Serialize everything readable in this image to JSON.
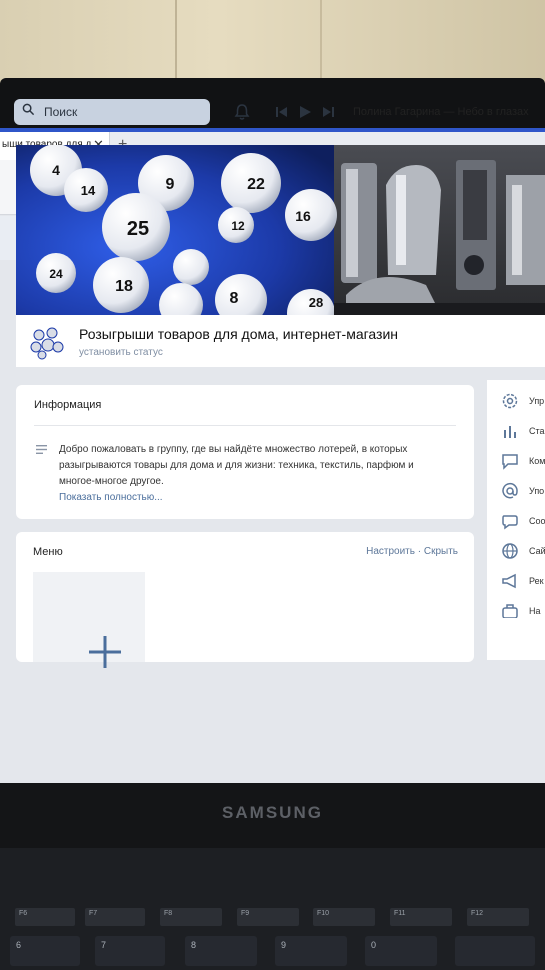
{
  "browser": {
    "tab_title": "ыши товаров для д",
    "tab_close": "✕",
    "new_tab": "+"
  },
  "header": {
    "search_placeholder": "Поиск",
    "now_playing": "Полина Гагарина — Небо в глазах"
  },
  "cover": {
    "ball_numbers": [
      "4",
      "14",
      "9",
      "22",
      "25",
      "12",
      "16",
      "24",
      "18",
      "8",
      "28"
    ]
  },
  "group": {
    "name": "Розыгрыши товаров для дома, интернет-магазин",
    "status_link": "установить статус"
  },
  "info": {
    "title": "Информация",
    "description": "Добро пожаловать в группу, где вы найдёте множество лотерей, в которых разыгрываются товары для дома и для жизни: техника, текстиль, парфюм и многое-многое другое.",
    "show_more": "Показать полностью..."
  },
  "menu": {
    "title": "Меню",
    "actions": "Настроить · Скрыть"
  },
  "sidebar": {
    "items": [
      {
        "label": "Упр",
        "icon": "gear-icon"
      },
      {
        "label": "Ста",
        "icon": "stats-icon"
      },
      {
        "label": "Ком",
        "icon": "comment-icon"
      },
      {
        "label": "Упо",
        "icon": "at-icon"
      },
      {
        "label": "Соо",
        "icon": "messages-icon"
      },
      {
        "label": "Сай",
        "icon": "globe-icon"
      },
      {
        "label": "Рек",
        "icon": "megaphone-icon"
      },
      {
        "label": "На",
        "icon": "briefcase-icon"
      }
    ]
  },
  "device": {
    "brand": "SAMSUNG",
    "fkeys": [
      "F6",
      "F7",
      "F8",
      "F9",
      "F10",
      "F11",
      "F12"
    ],
    "number_keys": [
      "6",
      "7",
      "8",
      "9",
      "0"
    ]
  },
  "colors": {
    "accent": "#2f56c9",
    "link": "#4a6e9c",
    "muted": "#7f8ea3"
  }
}
